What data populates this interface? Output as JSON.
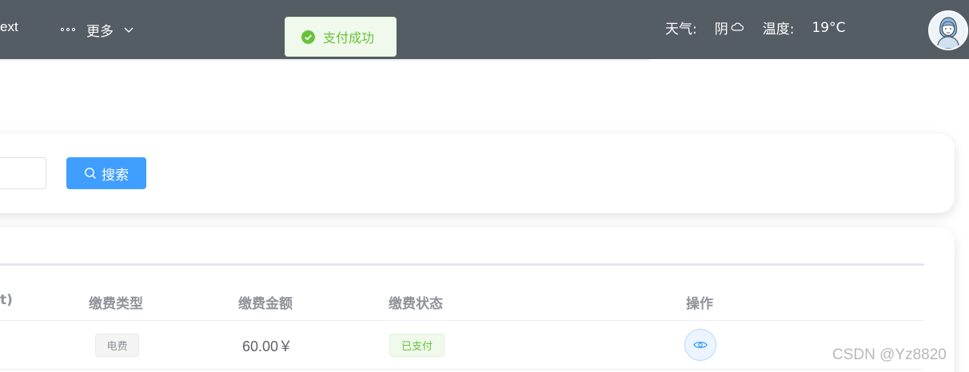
{
  "header": {
    "nav_fragment": "ext",
    "more_label": "更多",
    "weather_label": "天气:",
    "weather_value": "阴",
    "temp_label": "温度:",
    "temp_value": "19°C"
  },
  "toast": {
    "message": "支付成功"
  },
  "search": {
    "button_label": "搜索"
  },
  "table": {
    "columns": [
      "t)",
      "缴费类型",
      "缴费金额",
      "缴费状态",
      "操作"
    ],
    "rows": [
      {
        "type": "电费",
        "amount": "60.00￥",
        "status": "已支付"
      }
    ]
  },
  "watermark": "CSDN @Yz8820",
  "colors": {
    "header_bg": "#545c64",
    "primary": "#409eff",
    "success": "#67c23a"
  },
  "icons": {
    "more": "more-dots-icon",
    "chevron": "chevron-down-icon",
    "weather": "cloud-icon",
    "toast": "check-circle-icon",
    "search": "search-icon",
    "view": "eye-icon"
  }
}
